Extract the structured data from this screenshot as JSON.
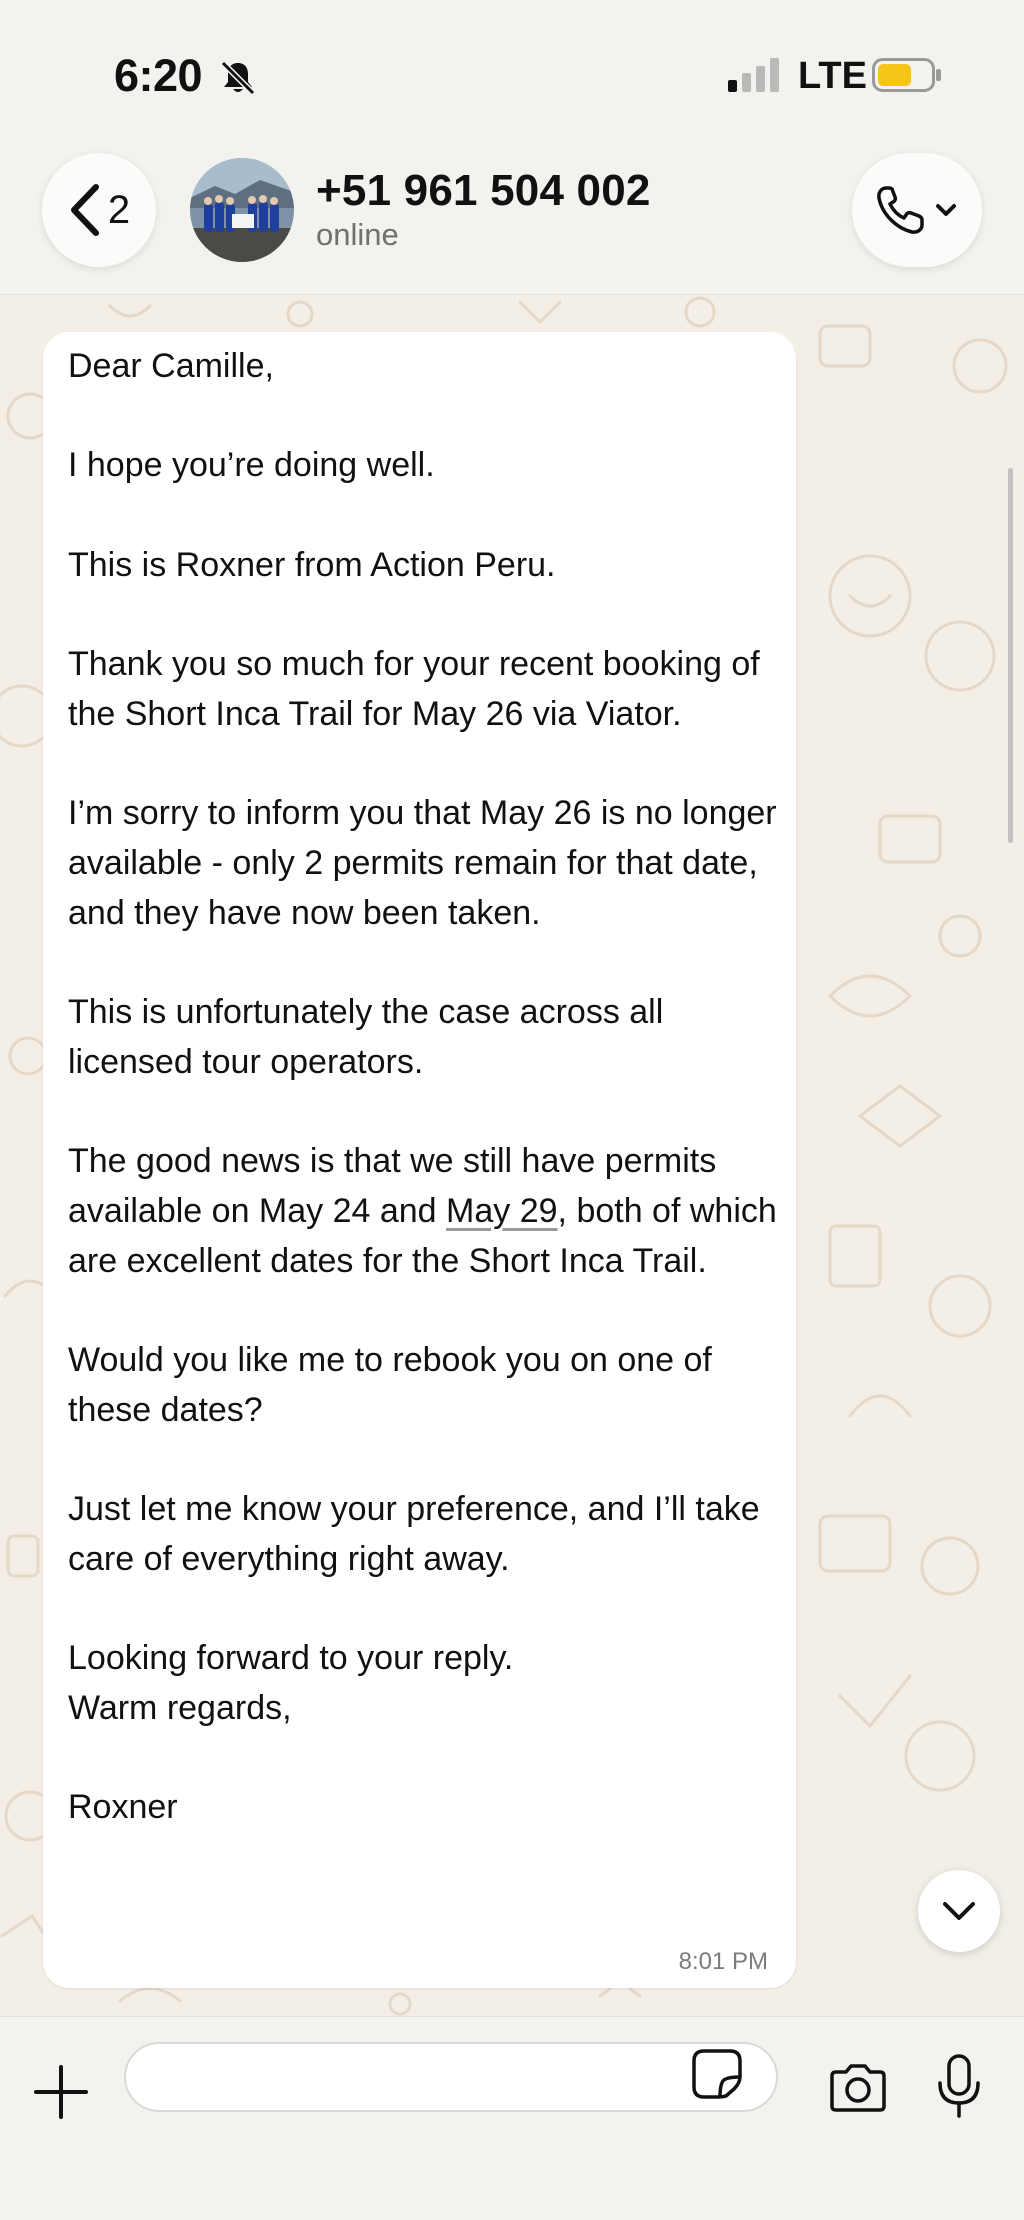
{
  "status_bar": {
    "time": "6:20",
    "network": "LTE"
  },
  "header": {
    "back_count": "2",
    "contact_name": "+51 961 504 002",
    "contact_status": "online"
  },
  "message": {
    "paragraphs": [
      "Dear Camille,",
      "I hope you’re doing well.",
      "This is Roxner from Action Peru.",
      "Thank you so much for your recent booking of the Short Inca Trail for May 26 via Viator.",
      "I’m sorry to inform you that May 26 is no longer available - only 2 permits remain for that date, and they have now been taken.",
      "This is unfortunately the case across all licensed tour operators."
    ],
    "p7_before": "The good news is that we still have permits available on May 24 and ",
    "p7_link": "May 29",
    "p7_after": ", both of which are excellent dates for the Short Inca Trail.",
    "p8": "Would you like me to rebook you on one of these dates?",
    "p9": "Just let me know your preference, and I’ll take care of everything right away.",
    "p10_line1": "Looking forward to your reply.",
    "p10_line2": "Warm regards,",
    "signature": "Roxner",
    "time": "8:01 PM"
  },
  "input_bar": {
    "placeholder": ""
  },
  "icons": {
    "back": "chevron-left-icon",
    "call": "phone-icon",
    "scroll": "chevron-down-icon",
    "attach": "plus-icon",
    "sticker": "sticker-icon",
    "camera": "camera-icon",
    "mic": "microphone-icon",
    "silent": "bell-slash-icon"
  },
  "colors": {
    "battery_fill": "#f5c518",
    "chat_background": "#f3eee6",
    "bubble": "#ffffff"
  }
}
